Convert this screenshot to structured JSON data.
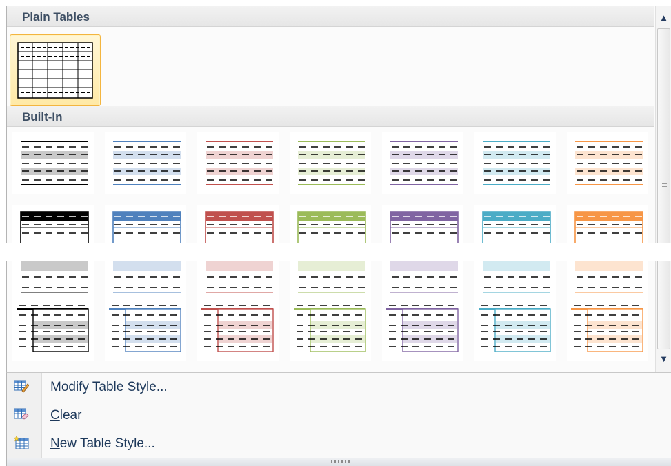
{
  "sections": {
    "plain_title": "Plain Tables",
    "builtin_title": "Built-In"
  },
  "menu": {
    "items": [
      {
        "key": "M",
        "rest": "odify Table Style...",
        "icon": "modify-table-style-icon"
      },
      {
        "key": "C",
        "rest": "lear",
        "icon": "clear-table-icon"
      },
      {
        "key": "N",
        "rest": "ew Table Style...",
        "icon": "new-table-style-icon"
      }
    ]
  },
  "colors": {
    "accents": [
      "#000000",
      "#4f81bd",
      "#c0504d",
      "#9bbb59",
      "#8064a2",
      "#4bacc6",
      "#f79646"
    ],
    "tints": [
      "#c9c9c9",
      "#d3dfee",
      "#efd3d2",
      "#e6eed5",
      "#dfd8e8",
      "#d2eaf1",
      "#fde4d0"
    ],
    "hover_border": "#f3b53f",
    "header_text": "#3d4e63",
    "menu_text": "#1e395b"
  }
}
